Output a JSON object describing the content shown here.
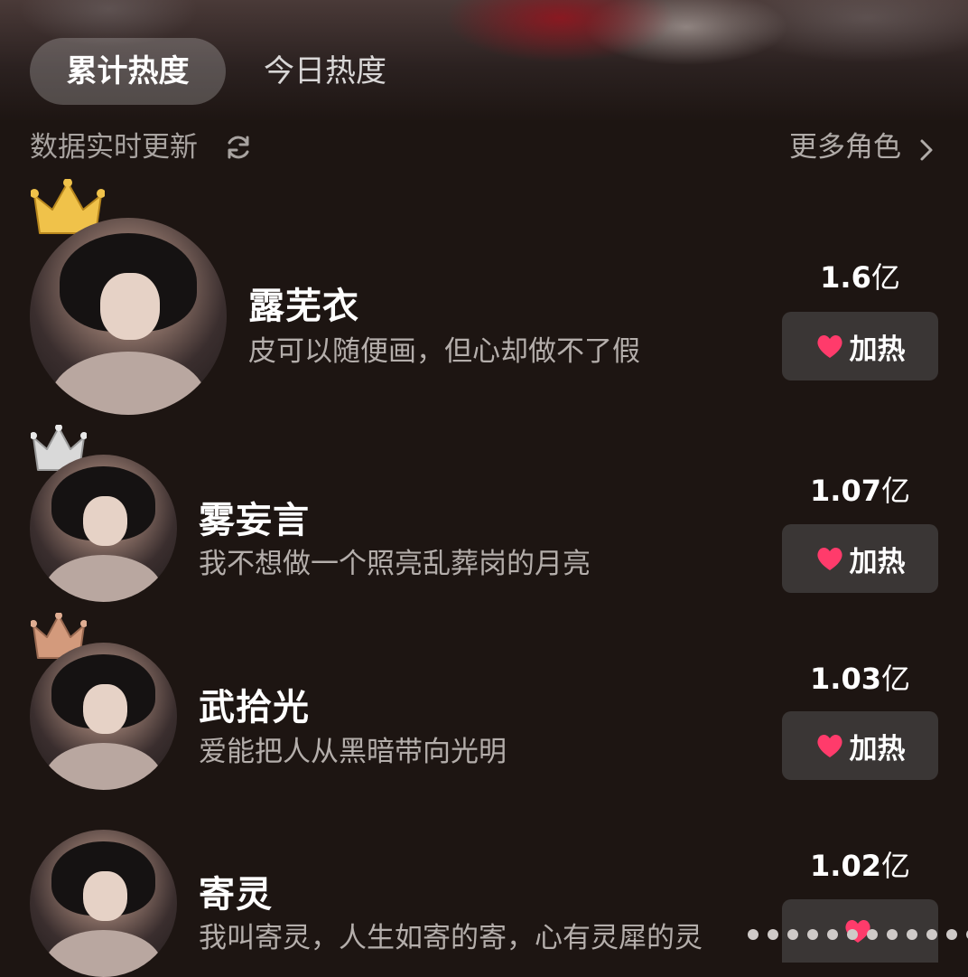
{
  "tabs": {
    "active": "累计热度",
    "inactive": "今日热度"
  },
  "status": {
    "text": "数据实时更新",
    "refresh_icon": "refresh-icon"
  },
  "more": {
    "label": "更多角色",
    "icon": "chevron-right-icon"
  },
  "colors": {
    "gold": "#f0c24a",
    "silver": "#d9d9d9",
    "bronze": "#d39a7c",
    "heart": "#ff3b6b"
  },
  "characters": [
    {
      "name": "露芜衣",
      "quote": "皮可以随便画，但心却做不了假",
      "heat_value": "1.6",
      "heat_unit": "亿",
      "boost_label": "加热",
      "crown": "gold"
    },
    {
      "name": "雾妄言",
      "quote": "我不想做一个照亮乱葬岗的月亮",
      "heat_value": "1.07",
      "heat_unit": "亿",
      "boost_label": "加热",
      "crown": "silver"
    },
    {
      "name": "武拾光",
      "quote": "爱能把人从黑暗带向光明",
      "heat_value": "1.03",
      "heat_unit": "亿",
      "boost_label": "加热",
      "crown": "bronze"
    },
    {
      "name": "寄灵",
      "quote": "我叫寄灵，人生如寄的寄，心有灵犀的灵",
      "heat_value": "1.02",
      "heat_unit": "亿",
      "boost_label": "",
      "crown": "none"
    }
  ]
}
